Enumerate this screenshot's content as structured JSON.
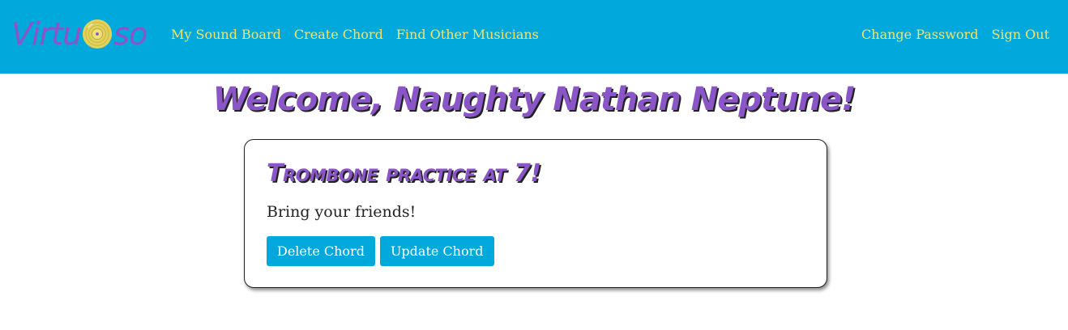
{
  "colors": {
    "navbar_bg": "#00a8dc",
    "nav_link": "#f2e46d",
    "brand_purple": "#8a55c7",
    "button_bg": "#00a8dc",
    "button_text": "#ffffff"
  },
  "navbar": {
    "brand_left": "Virtu",
    "brand_icon": "vinyl-record-icon",
    "brand_right": "so",
    "left_links": [
      "My Sound Board",
      "Create Chord",
      "Find Other Musicians"
    ],
    "right_links": [
      "Change Password",
      "Sign Out"
    ]
  },
  "main": {
    "welcome": "Welcome, Naughty Nathan Neptune!"
  },
  "chord_card": {
    "title": "Trombone practice at 7!",
    "body": "Bring your friends!",
    "delete_label": "Delete Chord",
    "update_label": "Update Chord"
  }
}
